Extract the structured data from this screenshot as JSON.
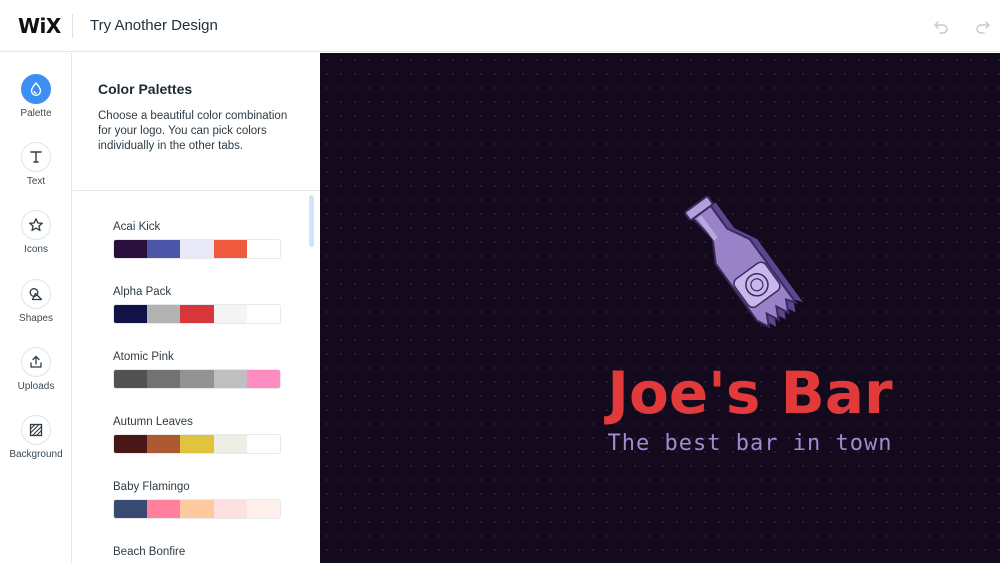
{
  "header": {
    "logo": "WiX",
    "title": "Try Another Design"
  },
  "rail": {
    "items": [
      {
        "label": "Palette",
        "icon": "palette-drop-icon",
        "active": true
      },
      {
        "label": "Text",
        "icon": "text-icon"
      },
      {
        "label": "Icons",
        "icon": "star-icon"
      },
      {
        "label": "Shapes",
        "icon": "shapes-icon"
      },
      {
        "label": "Uploads",
        "icon": "upload-icon"
      },
      {
        "label": "Background",
        "icon": "background-icon"
      }
    ]
  },
  "panel": {
    "title": "Color Palettes",
    "description": "Choose a beautiful color combination for your logo. You can pick colors individually in the other tabs.",
    "palettes": [
      {
        "name": "Acai Kick",
        "colors": [
          "#2a0f3d",
          "#4b56a8",
          "#e8e8f6",
          "#ef5a3f",
          "#ffffff"
        ]
      },
      {
        "name": "Alpha Pack",
        "colors": [
          "#121249",
          "#b2b2b2",
          "#d73739",
          "#f4f4f4",
          "#ffffff"
        ]
      },
      {
        "name": "Atomic Pink",
        "colors": [
          "#525252",
          "#727272",
          "#939393",
          "#bfbfbf",
          "#ff8cc0"
        ]
      },
      {
        "name": "Autumn Leaves",
        "colors": [
          "#4a1717",
          "#ad5a33",
          "#e1c43d",
          "#efeee4",
          "#ffffff"
        ]
      },
      {
        "name": "Baby Flamingo",
        "colors": [
          "#394a72",
          "#ff7f9c",
          "#ffcaa0",
          "#fde0e1",
          "#fff0ee"
        ]
      },
      {
        "name": "Beach Bonfire",
        "colors": []
      }
    ]
  },
  "canvas": {
    "background": "#140a1d",
    "brand_name": "Joe's Bar",
    "tagline": "The best bar in town",
    "brand_color": "#e2393a",
    "tagline_color": "#a08ad0",
    "icon": "beer-bottle-icon"
  }
}
